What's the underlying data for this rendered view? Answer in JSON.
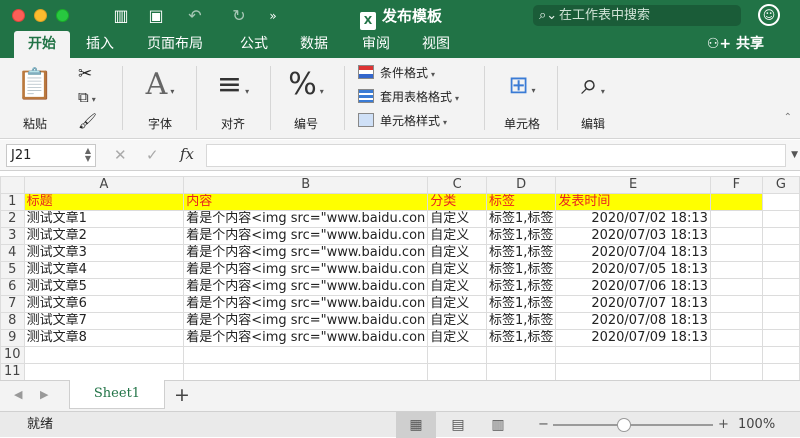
{
  "window": {
    "title": "发布模板",
    "search_placeholder": "在工作表中搜索"
  },
  "tabs": [
    "开始",
    "插入",
    "页面布局",
    "公式",
    "数据",
    "审阅",
    "视图"
  ],
  "share_label": "共享",
  "ribbon": {
    "paste": "粘贴",
    "font": "字体",
    "align": "对齐",
    "number": "编号",
    "cond_format": "条件格式",
    "table_format": "套用表格格式",
    "cell_style": "单元格样式",
    "cells": "单元格",
    "edit": "编辑"
  },
  "formula": {
    "name_box": "J21",
    "fx": "fx",
    "value": ""
  },
  "columns": [
    "A",
    "B",
    "C",
    "D",
    "E",
    "F",
    "G"
  ],
  "header_row": [
    "标题",
    "内容",
    "分类",
    "标签",
    "发表时间"
  ],
  "rows": [
    [
      "测试文章1",
      "着是个内容<img src=\"www.baidu.con",
      "自定义",
      "标签1,标签",
      "2020/07/02 18:13"
    ],
    [
      "测试文章2",
      "着是个内容<img src=\"www.baidu.con",
      "自定义",
      "标签1,标签",
      "2020/07/03 18:13"
    ],
    [
      "测试文章3",
      "着是个内容<img src=\"www.baidu.con",
      "自定义",
      "标签1,标签",
      "2020/07/04 18:13"
    ],
    [
      "测试文章4",
      "着是个内容<img src=\"www.baidu.con",
      "自定义",
      "标签1,标签",
      "2020/07/05 18:13"
    ],
    [
      "测试文章5",
      "着是个内容<img src=\"www.baidu.con",
      "自定义",
      "标签1,标签",
      "2020/07/06 18:13"
    ],
    [
      "测试文章6",
      "着是个内容<img src=\"www.baidu.con",
      "自定义",
      "标签1,标签",
      "2020/07/07 18:13"
    ],
    [
      "测试文章7",
      "着是个内容<img src=\"www.baidu.con",
      "自定义",
      "标签1,标签",
      "2020/07/08 18:13"
    ],
    [
      "测试文章8",
      "着是个内容<img src=\"www.baidu.con",
      "自定义",
      "标签1,标签",
      "2020/07/09 18:13"
    ]
  ],
  "row_numbers": [
    "1",
    "2",
    "3",
    "4",
    "5",
    "6",
    "7",
    "8",
    "9",
    "10",
    "11"
  ],
  "sheet_tab": "Sheet1",
  "add_sheet": "+",
  "status": "就绪",
  "zoom": "100%",
  "zoom_level_percent": 100,
  "colors": {
    "accent": "#217346",
    "header_fill": "#ffff00",
    "header_text": "#e8251f"
  }
}
